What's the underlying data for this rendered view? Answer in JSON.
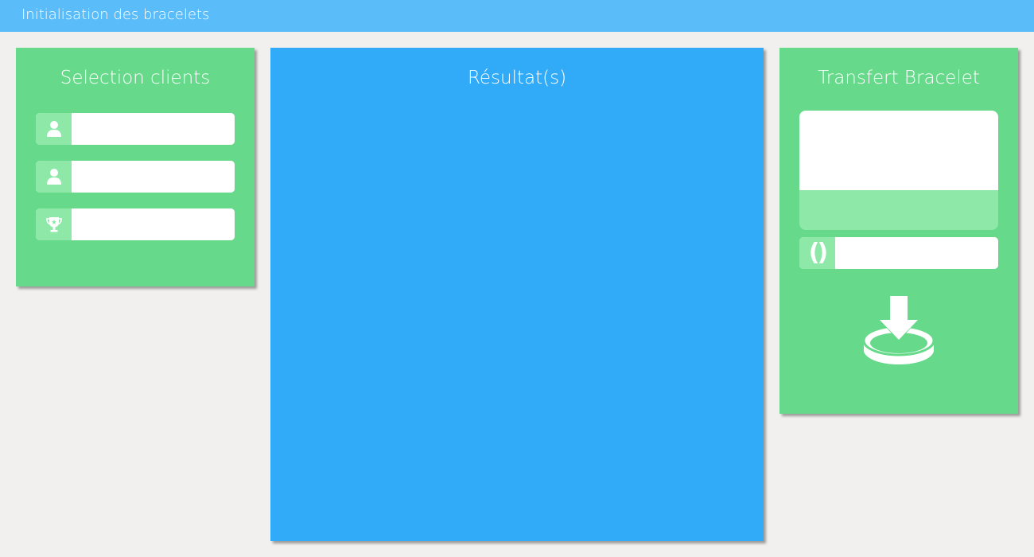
{
  "app": {
    "title": "Initialisation des bracelets"
  },
  "colors": {
    "topbar": "#5bbcfa",
    "panel_green": "#66da8a",
    "panel_blue": "#31aaf8",
    "icon_bg": "#8ee9a9",
    "background": "#f2f0ee"
  },
  "selection": {
    "title": "Selection clients",
    "fields": [
      {
        "icon": "user-icon",
        "value": "",
        "placeholder": ""
      },
      {
        "icon": "user-icon",
        "value": "",
        "placeholder": ""
      },
      {
        "icon": "trophy-icon",
        "value": "",
        "placeholder": ""
      }
    ]
  },
  "results": {
    "title": "Résultat(s)"
  },
  "transfer": {
    "title": "Transfert Bracelet",
    "bracelet_field": {
      "icon": "bracelet-icon",
      "icon_text": "()",
      "value": "",
      "placeholder": ""
    },
    "download_icon": "download-to-bracelet-icon"
  }
}
